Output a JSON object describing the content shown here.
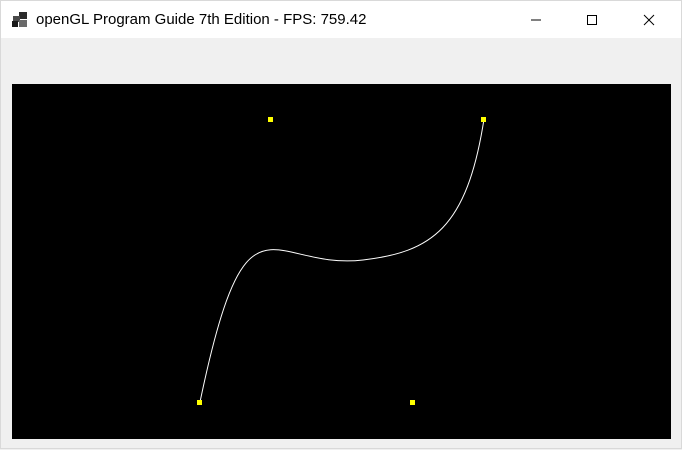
{
  "window": {
    "title": "openGL Program Guide 7th Edition - FPS: 759.42",
    "app_icon": "opengl-app-icon",
    "controls": {
      "minimize_icon": "minimize-icon",
      "maximize_icon": "maximize-icon",
      "close_icon": "close-icon"
    }
  },
  "colors": {
    "canvas_background": "#000000",
    "curve": "#ffffff",
    "control_point": "#ffff00",
    "window_background": "#f0f0f0",
    "titlebar": "#ffffff"
  }
}
